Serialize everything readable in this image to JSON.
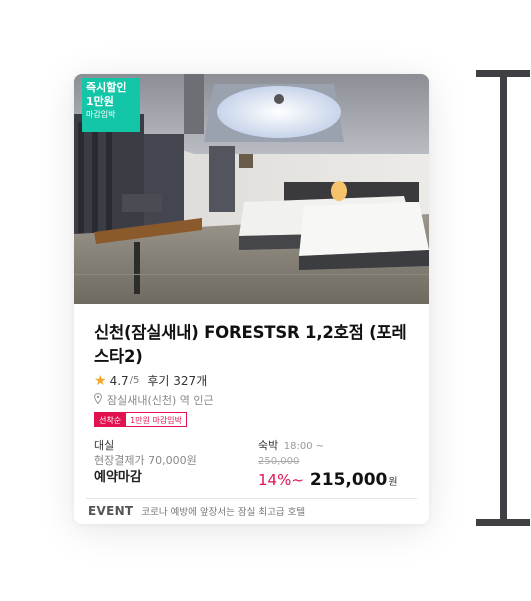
{
  "promo_badge": {
    "line1": "즉시할인",
    "line2": "1만원",
    "line3": "마감임박"
  },
  "hotel": {
    "name": "신천(잠실새내) FORESTSR 1,2호점 (포레스타2)",
    "rating": "4.7",
    "rating_out_of": "/5",
    "reviews": "후기 327개",
    "location": "잠실새내(신천) 역 인근"
  },
  "tags": {
    "first": "선착순",
    "second": "1만원 마감임박"
  },
  "daily": {
    "label": "대실",
    "onsite_payment": "현장결제가 70,000원",
    "status": "예약마감"
  },
  "overnight": {
    "label": "숙박",
    "checkin_time": "18:00 ~",
    "original_price": "250,000",
    "discount": "14%~",
    "price": "215,000",
    "currency": "원"
  },
  "event": {
    "label": "EVENT",
    "text": "코로나 예방에 앞장서는 잠실 최고급 호텔"
  },
  "colors": {
    "accent": "#e2124f",
    "promo": "#14c6a8",
    "star": "#f5a623"
  }
}
